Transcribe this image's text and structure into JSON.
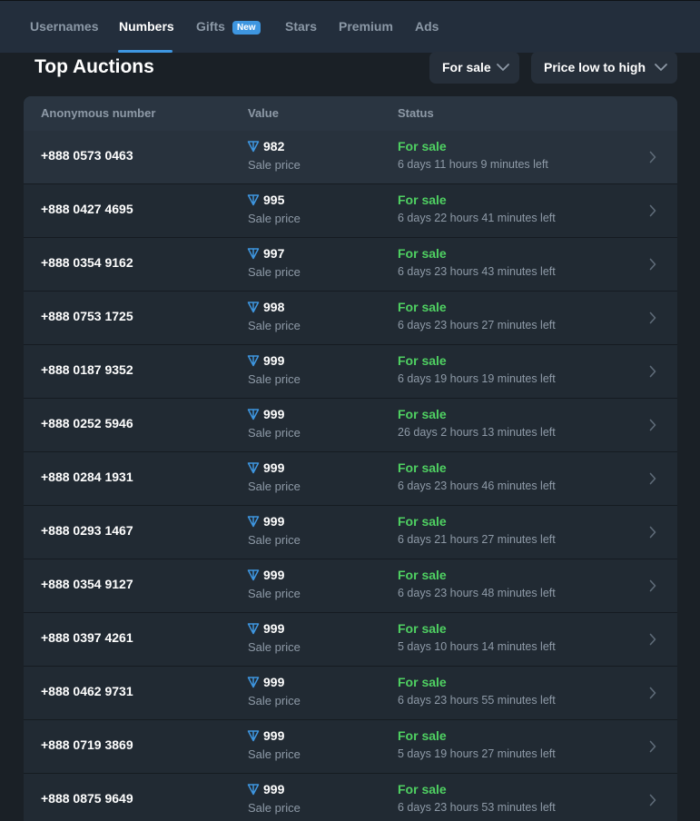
{
  "tabs": [
    {
      "label": "Usernames",
      "active": false
    },
    {
      "label": "Numbers",
      "active": true
    },
    {
      "label": "Gifts",
      "active": false,
      "badge": "New"
    },
    {
      "label": "Stars",
      "active": false
    },
    {
      "label": "Premium",
      "active": false
    },
    {
      "label": "Ads",
      "active": false
    }
  ],
  "page_title": "Top Auctions",
  "filters": {
    "status_filter": "For sale",
    "sort": "Price low to high"
  },
  "table": {
    "headers": [
      "Anonymous number",
      "Value",
      "Status"
    ],
    "price_label": "Sale price",
    "rows": [
      {
        "number": "+888 0573 0463",
        "price": "982",
        "status": "For sale",
        "time_left": "6 days 11 hours 9 minutes left"
      },
      {
        "number": "+888 0427 4695",
        "price": "995",
        "status": "For sale",
        "time_left": "6 days 22 hours 41 minutes left"
      },
      {
        "number": "+888 0354 9162",
        "price": "997",
        "status": "For sale",
        "time_left": "6 days 23 hours 43 minutes left"
      },
      {
        "number": "+888 0753 1725",
        "price": "998",
        "status": "For sale",
        "time_left": "6 days 23 hours 27 minutes left"
      },
      {
        "number": "+888 0187 9352",
        "price": "999",
        "status": "For sale",
        "time_left": "6 days 19 hours 19 minutes left"
      },
      {
        "number": "+888 0252 5946",
        "price": "999",
        "status": "For sale",
        "time_left": "26 days 2 hours 13 minutes left"
      },
      {
        "number": "+888 0284 1931",
        "price": "999",
        "status": "For sale",
        "time_left": "6 days 23 hours 46 minutes left"
      },
      {
        "number": "+888 0293 1467",
        "price": "999",
        "status": "For sale",
        "time_left": "6 days 21 hours 27 minutes left"
      },
      {
        "number": "+888 0354 9127",
        "price": "999",
        "status": "For sale",
        "time_left": "6 days 23 hours 48 minutes left"
      },
      {
        "number": "+888 0397 4261",
        "price": "999",
        "status": "For sale",
        "time_left": "5 days 10 hours 14 minutes left"
      },
      {
        "number": "+888 0462 9731",
        "price": "999",
        "status": "For sale",
        "time_left": "6 days 23 hours 55 minutes left"
      },
      {
        "number": "+888 0719 3869",
        "price": "999",
        "status": "For sale",
        "time_left": "5 days 19 hours 27 minutes left"
      },
      {
        "number": "+888 0875 9649",
        "price": "999",
        "status": "For sale",
        "time_left": "6 days 23 hours 53 minutes left"
      }
    ]
  },
  "icons": {
    "currency": "ton-icon",
    "row_action": "chevron-right-icon",
    "dropdown": "chevron-down-icon"
  },
  "colors": {
    "accent": "#3e96e0",
    "status_for_sale": "#4fd162",
    "background": "#1a2026",
    "card": "#212a33"
  }
}
